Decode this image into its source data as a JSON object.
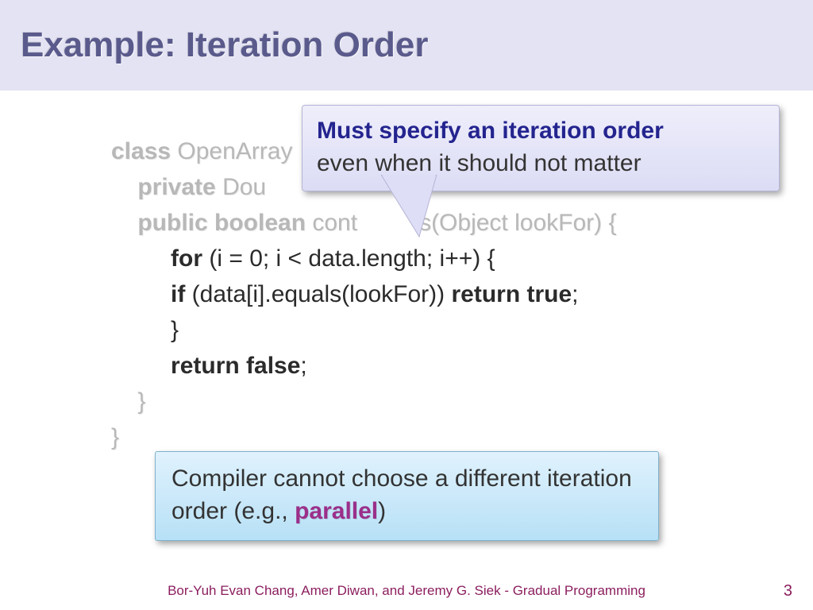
{
  "slide": {
    "title": "Example: Iteration Order"
  },
  "code": {
    "l1_kw": "class",
    "l1_rest": " OpenArray",
    "l2_kw": "private",
    "l2_rest": " Dou",
    "l3a_kw": "public boolean",
    "l3a_mid": " cont",
    "l3b_mid": "s(Object lookFor) {",
    "l4_kw": "for",
    "l4_rest": " (i = 0; i < data.length; i++) {",
    "l5_kw1": "if",
    "l5_mid": " (data[i].equals(lookFor)) ",
    "l5_kw2": "return true",
    "l5_semi": ";",
    "l6": "}",
    "l7_kw": "return false",
    "l7_semi": ";",
    "l8": "}",
    "l9": "}"
  },
  "callout_top": {
    "line1": "Must specify an iteration order",
    "line2": "even when it should not matter"
  },
  "callout_bottom": {
    "pre": "Compiler cannot choose a different iteration order (e.g., ",
    "emph": "parallel",
    "post": ")"
  },
  "footer": {
    "text": "Bor-Yuh Evan Chang, Amer Diwan, and Jeremy G. Siek - Gradual Programming",
    "page": "3"
  }
}
